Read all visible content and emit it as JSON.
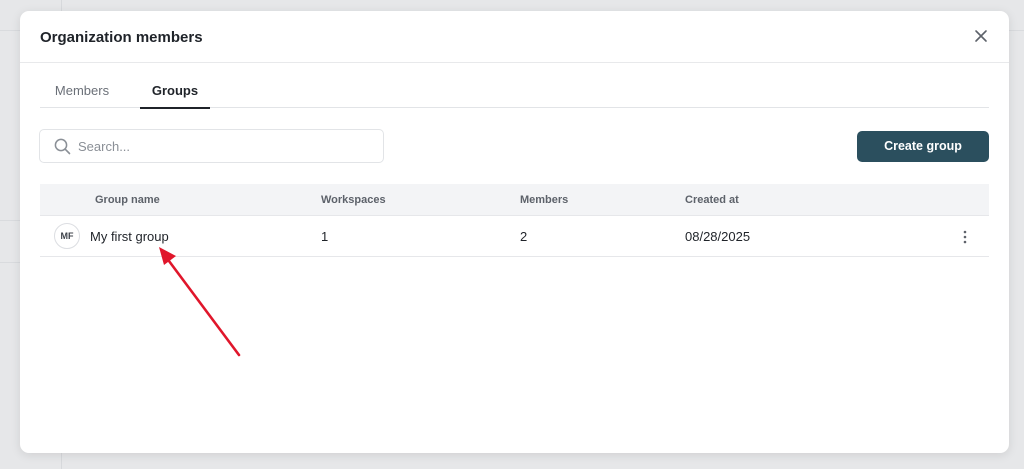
{
  "modal": {
    "title": "Organization members"
  },
  "tabs": [
    {
      "label": "Members",
      "active": false
    },
    {
      "label": "Groups",
      "active": true
    }
  ],
  "search": {
    "placeholder": "Search...",
    "value": ""
  },
  "toolbar": {
    "create_label": "Create group"
  },
  "table": {
    "columns": [
      "Group name",
      "Workspaces",
      "Members",
      "Created at"
    ],
    "rows": [
      {
        "avatar": "MF",
        "name": "My first group",
        "workspaces": "1",
        "members": "2",
        "created_at": "08/28/2025"
      }
    ]
  },
  "colors": {
    "primary_button": "#2b4f5e",
    "annotation_arrow": "#e0162b"
  },
  "icons": {
    "close": "close-icon",
    "search": "search-icon",
    "row_menu": "more-vertical-icon"
  }
}
